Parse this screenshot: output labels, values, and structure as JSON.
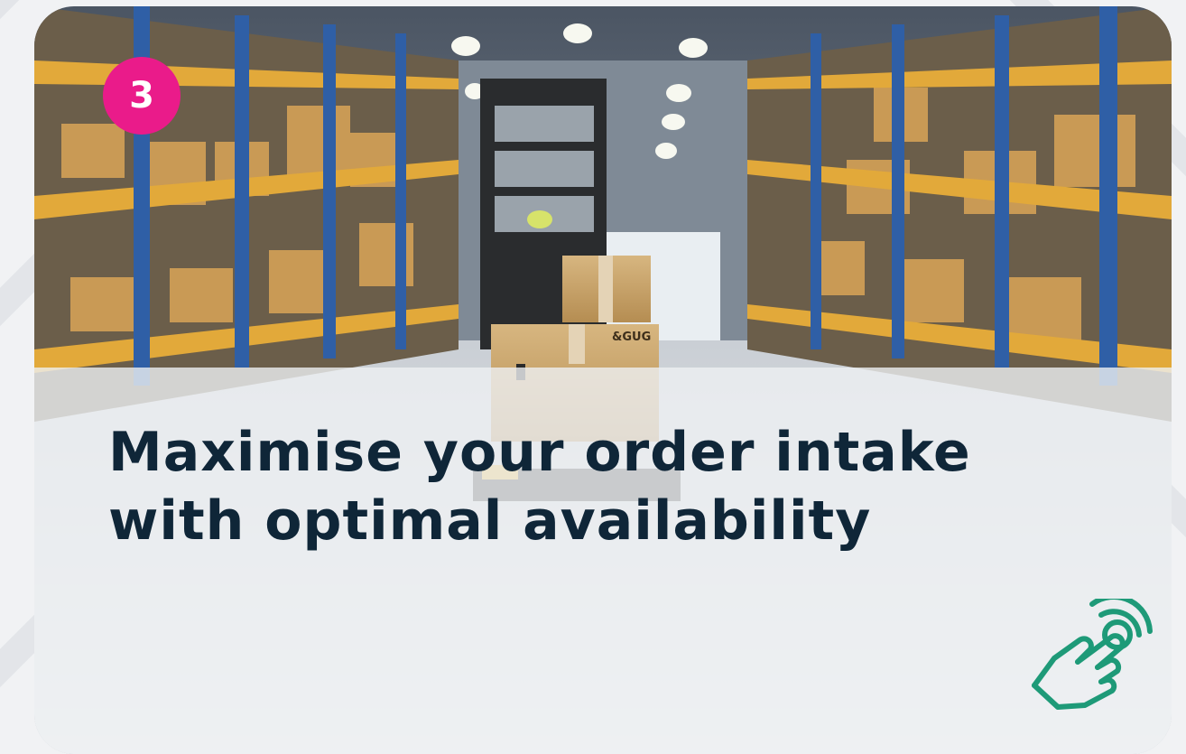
{
  "step": {
    "number": "3"
  },
  "card": {
    "headline": "Maximise your order intake with optimal availability",
    "image_subject": "warehouse-aisle-with-pallet-racking-and-cardboard-boxes"
  },
  "icons": {
    "tap": "hand-tap-icon"
  },
  "colors": {
    "badge": "#ea1b8a",
    "headline": "#0f2638",
    "icon": "#1e9a78",
    "rack_frame": "#2f5fa6",
    "rack_beam": "#e2a93a"
  }
}
